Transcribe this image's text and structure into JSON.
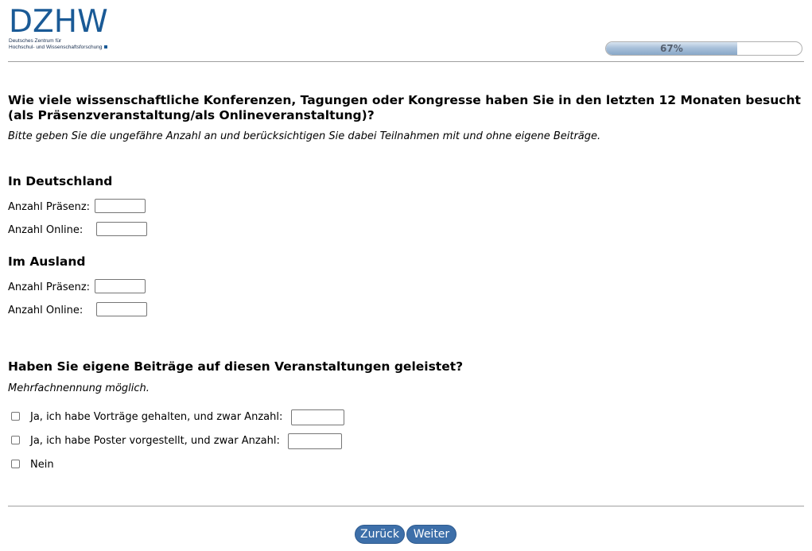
{
  "header": {
    "logo_text": "DZHW",
    "logo_sub_line1": "Deutsches Zentrum für",
    "logo_sub_line2": "Hochschul- und Wissenschaftsforschung",
    "progress_label": "67%",
    "progress_value": 0.67
  },
  "question1": {
    "title_line1": "Wie viele wissenschaftliche Konferenzen, Tagungen oder Kongresse haben Sie in den letzten 12 Monaten besucht",
    "title_line2": "(als Präsenzveranstaltung/als Onlineveranstaltung)?",
    "hint": "Bitte geben Sie die ungefähre Anzahl an und berücksichtigen Sie dabei Teilnahmen mit und ohne eigene Beiträge.",
    "sections": [
      {
        "title": "In Deutschland",
        "presence_label": "Anzahl Präsenz:",
        "presence_value": "",
        "online_label": "Anzahl Online:",
        "online_value": ""
      },
      {
        "title": "Im Ausland",
        "presence_label": "Anzahl Präsenz:",
        "presence_value": "",
        "online_label": "Anzahl Online:",
        "online_value": ""
      }
    ]
  },
  "question2": {
    "title": "Haben Sie eigene Beiträge auf diesen Veranstaltungen geleistet?",
    "hint": "Mehrfachnennung möglich.",
    "options": [
      {
        "label": "Ja, ich habe Vorträge gehalten, und zwar Anzahl:",
        "checked": false,
        "count_value": ""
      },
      {
        "label": "Ja, ich habe Poster vorgestellt, und zwar Anzahl:",
        "checked": false,
        "count_value": ""
      },
      {
        "label": "Nein",
        "checked": false
      }
    ]
  },
  "nav": {
    "back_label": "Zurück",
    "next_label": "Weiter"
  },
  "colors": {
    "brand": "#1a5a96",
    "button": "#3d6fa9",
    "progress_fill": "#88a7c8"
  }
}
